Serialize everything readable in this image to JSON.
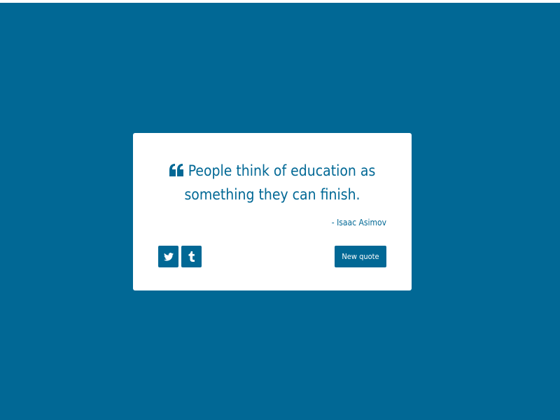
{
  "colors": {
    "background": "#016895",
    "card": "#ffffff",
    "accent": "#016895",
    "button_text": "#ffffff"
  },
  "quote": {
    "icon": "quote-left-icon",
    "text": "People think of education as something they can finish.",
    "author": "- Isaac Asimov"
  },
  "actions": {
    "twitter_icon": "twitter-icon",
    "tumblr_icon": "tumblr-icon",
    "new_quote_label": "New quote"
  }
}
